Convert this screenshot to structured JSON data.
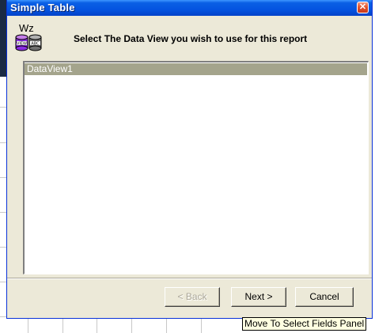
{
  "window": {
    "title": "Simple Table",
    "close_glyph": "✕"
  },
  "header": {
    "logo_text": "Wz",
    "logo_icon": "view-abc-icon",
    "instruction": "Select The Data View you wish to use for this report"
  },
  "list": {
    "items": [
      {
        "label": "DataView1",
        "selected": true
      }
    ]
  },
  "buttons": {
    "back_label": "< Back",
    "back_enabled": false,
    "next_label": "Next >",
    "cancel_label": "Cancel"
  },
  "tooltip": {
    "text": "Move To Select Fields Panel"
  },
  "colors": {
    "titlebar": "#0454e0",
    "dialog_bg": "#ece9d8",
    "selection": "#a4a48c",
    "tooltip_bg": "#ffffe1"
  }
}
